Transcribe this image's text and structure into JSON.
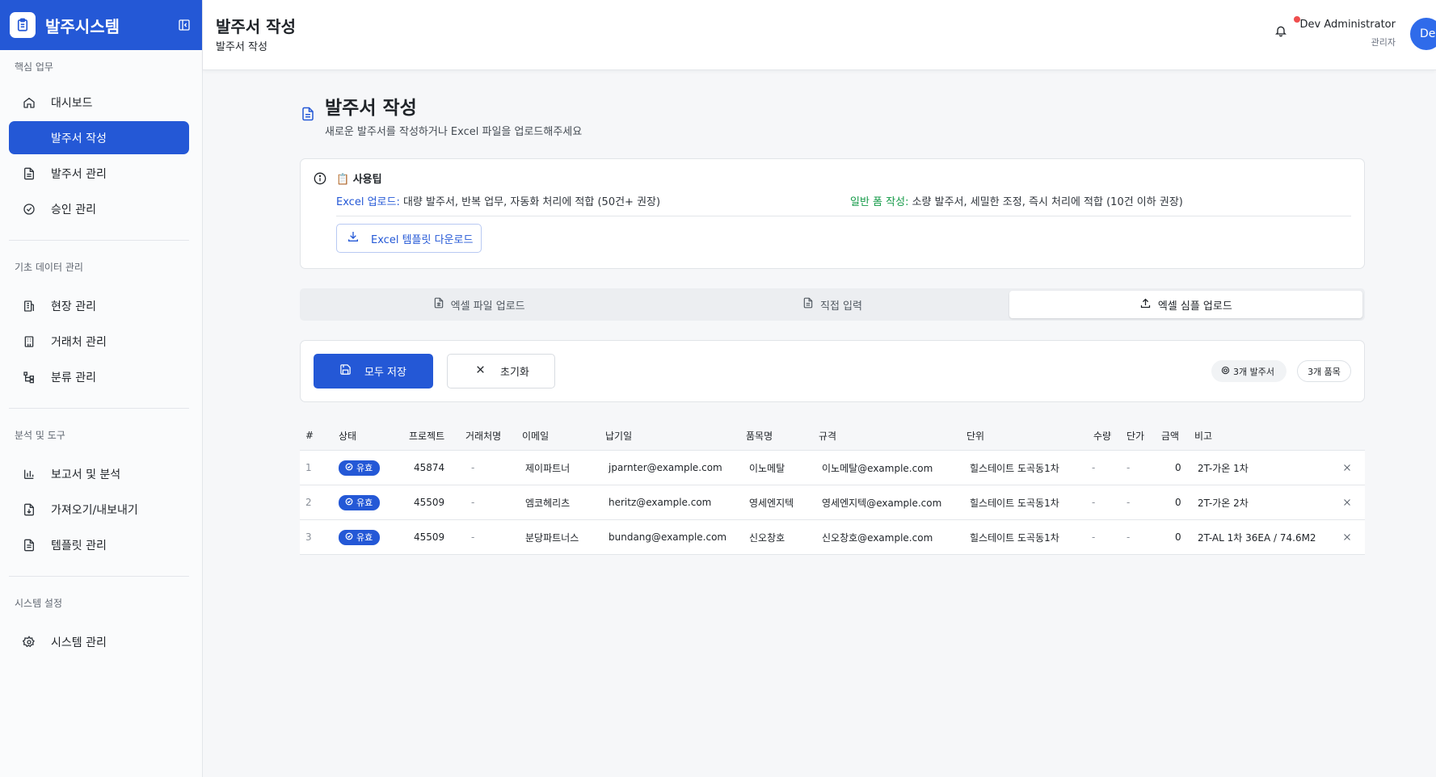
{
  "app": {
    "title": "발주시스템"
  },
  "sidebar": {
    "sections": [
      {
        "title": "핵심 업무",
        "items": [
          "대시보드",
          "발주서 작성",
          "발주서 관리",
          "승인 관리"
        ]
      },
      {
        "title": "기초 데이터 관리",
        "items": [
          "현장 관리",
          "거래처 관리",
          "분류 관리"
        ]
      },
      {
        "title": "분석 및 도구",
        "items": [
          "보고서 및 분석",
          "가져오기/내보내기",
          "템플릿 관리"
        ]
      },
      {
        "title": "시스템 설정",
        "items": [
          "시스템 관리"
        ]
      }
    ],
    "active_item": "발주서 작성"
  },
  "header": {
    "title": "발주서 작성",
    "subtitle": "발주서 작성",
    "user_name": "Dev Administrator",
    "user_role": "관리자",
    "avatar_initials": "De"
  },
  "page": {
    "title": "발주서 작성",
    "description": "새로운 발주서를 작성하거나 Excel 파일을 업로드해주세요"
  },
  "tips": {
    "title": "📋 사용팁",
    "excel_label": "Excel 업로드:",
    "excel_text": " 대량 발주서, 반복 업무, 자동화 처리에 적합 (50건+ 권장)",
    "form_label": "일반 폼 작성:",
    "form_text": " 소량 발주서, 세밀한 조정, 즉시 처리에 적합 (10건 이하 권장)",
    "template_button": "Excel 템플릿 다운로드"
  },
  "tabs": [
    "엑셀 파일 업로드",
    "직접 입력",
    "엑셀 심플 업로드"
  ],
  "active_tab": "엑셀 심플 업로드",
  "actions": {
    "save_label": "모두 저장",
    "reset_label": "초기화",
    "orders_badge": "3개 발주서",
    "items_badge": "3개 품목"
  },
  "table": {
    "headers": [
      "#",
      "상태",
      "프로젝트",
      "거래처명",
      "이메일",
      "납기일",
      "품목명",
      "규격",
      "단위",
      "수량",
      "단가",
      "금액",
      "비고"
    ],
    "rows": [
      {
        "no": "1",
        "status": "유효",
        "project": "45874",
        "vendor": "-",
        "email": "제이파트너",
        "due": "jparnter@example.com",
        "item": "이노메탈",
        "spec": "이노메탈@example.com",
        "unit": "힐스테이트 도곡동1차",
        "qty": "-",
        "price": "-",
        "amount": "0",
        "note": "2T-가온 1차"
      },
      {
        "no": "2",
        "status": "유효",
        "project": "45509",
        "vendor": "-",
        "email": "엠코헤리츠",
        "due": "heritz@example.com",
        "item": "영세엔지텍",
        "spec": "영세엔지텍@example.com",
        "unit": "힐스테이트 도곡동1차",
        "qty": "-",
        "price": "-",
        "amount": "0",
        "note": "2T-가온 2차"
      },
      {
        "no": "3",
        "status": "유효",
        "project": "45509",
        "vendor": "-",
        "email": "분당파트너스",
        "due": "bundang@example.com",
        "item": "신오창호",
        "spec": "신오창호@example.com",
        "unit": "힐스테이트 도곡동1차",
        "qty": "-",
        "price": "-",
        "amount": "0",
        "note": "2T-AL 1차 36EA / 74.6M2"
      }
    ]
  },
  "colors": {
    "primary": "#2458d6",
    "green": "#169b49",
    "notification": "#ef4e4e"
  }
}
